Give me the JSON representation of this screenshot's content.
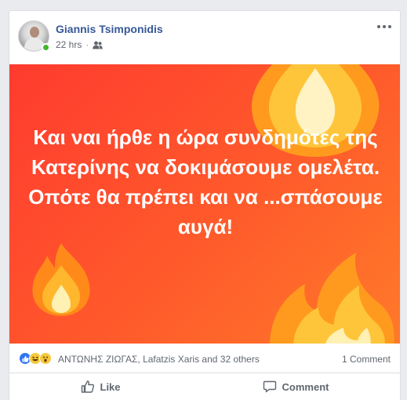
{
  "post": {
    "author": "Giannis Tsimponidis",
    "timestamp": "22 hrs",
    "separator": "·",
    "audience_icon": "friends-icon",
    "body_text": "Και ναι ήρθε η ώρα συνδημότες της Κατερίνης να δοκιμάσουμε ομελέτα. Οπότε θα πρέπει και να ...σπάσουμε αυγά!",
    "background_colors": [
      "#ff3b2f",
      "#ff7a2a"
    ]
  },
  "reactions": {
    "icons": [
      "like-reaction-icon",
      "haha-reaction-icon",
      "wow-reaction-icon"
    ],
    "summary": "ΑΝΤΩΝΗΣ ΖΙΩΓΑΣ, Lafatzis Xaris and 32 others",
    "comments": "1 Comment"
  },
  "actions": {
    "like_label": "Like",
    "comment_label": "Comment"
  },
  "colors": {
    "link_blue": "#365899",
    "meta_gray": "#616770",
    "online_green": "#42b72a"
  }
}
